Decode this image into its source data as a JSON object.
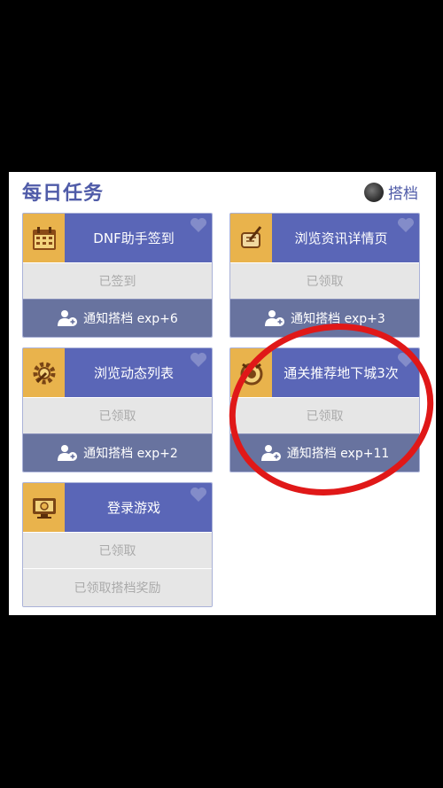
{
  "header": {
    "title": "每日任务",
    "partner_label": "搭档"
  },
  "tasks": [
    {
      "name": "DNF助手签到",
      "status": "已签到",
      "notify": "通知搭档 exp+6",
      "icon": "calendar-icon"
    },
    {
      "name": "浏览资讯详情页",
      "status": "已领取",
      "notify": "通知搭档 exp+3",
      "icon": "scroll-quill-icon"
    },
    {
      "name": "浏览动态列表",
      "status": "已领取",
      "notify": "通知搭档 exp+2",
      "icon": "gear-wrench-icon"
    },
    {
      "name": "通关推荐地下城3次",
      "status": "已领取",
      "notify": "通知搭档 exp+11",
      "icon": "dungeon-emblem-icon"
    },
    {
      "name": "登录游戏",
      "status": "已领取",
      "notify": "已领取搭档奖励",
      "icon": "monitor-icon"
    }
  ],
  "colors": {
    "card_header": "#5a66b7",
    "icon_bg": "#e9b34c",
    "notify_bg": "#68739f",
    "highlight_circle": "#e01818",
    "title": "#4f5ba8"
  }
}
